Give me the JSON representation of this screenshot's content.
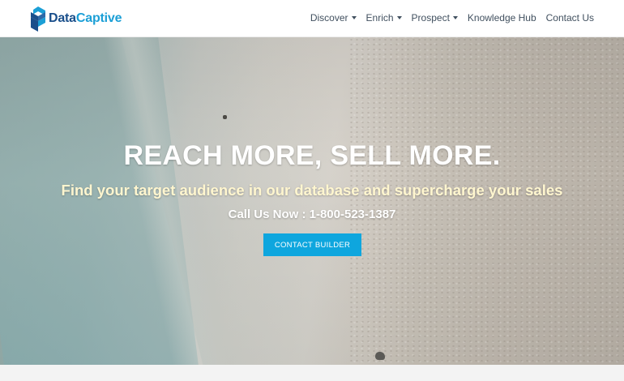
{
  "brand": {
    "name_part1": "Data",
    "name_part2": "Captive",
    "colors": {
      "dark_blue": "#1a4f8b",
      "light_blue": "#1b9fd6"
    }
  },
  "nav": {
    "items": [
      {
        "label": "Discover",
        "dropdown": true
      },
      {
        "label": "Enrich",
        "dropdown": true
      },
      {
        "label": "Prospect",
        "dropdown": true
      },
      {
        "label": "Knowledge Hub",
        "dropdown": false
      },
      {
        "label": "Contact Us",
        "dropdown": false
      }
    ]
  },
  "hero": {
    "title": "REACH MORE, SELL MORE.",
    "subtitle": "Find your target audience in our database and supercharge your sales",
    "phone": "Call Us Now : 1-800-523-1387",
    "cta_label": "CONTACT BUILDER",
    "cta_color": "#0ea6de",
    "subtitle_color": "#fff6cf"
  }
}
